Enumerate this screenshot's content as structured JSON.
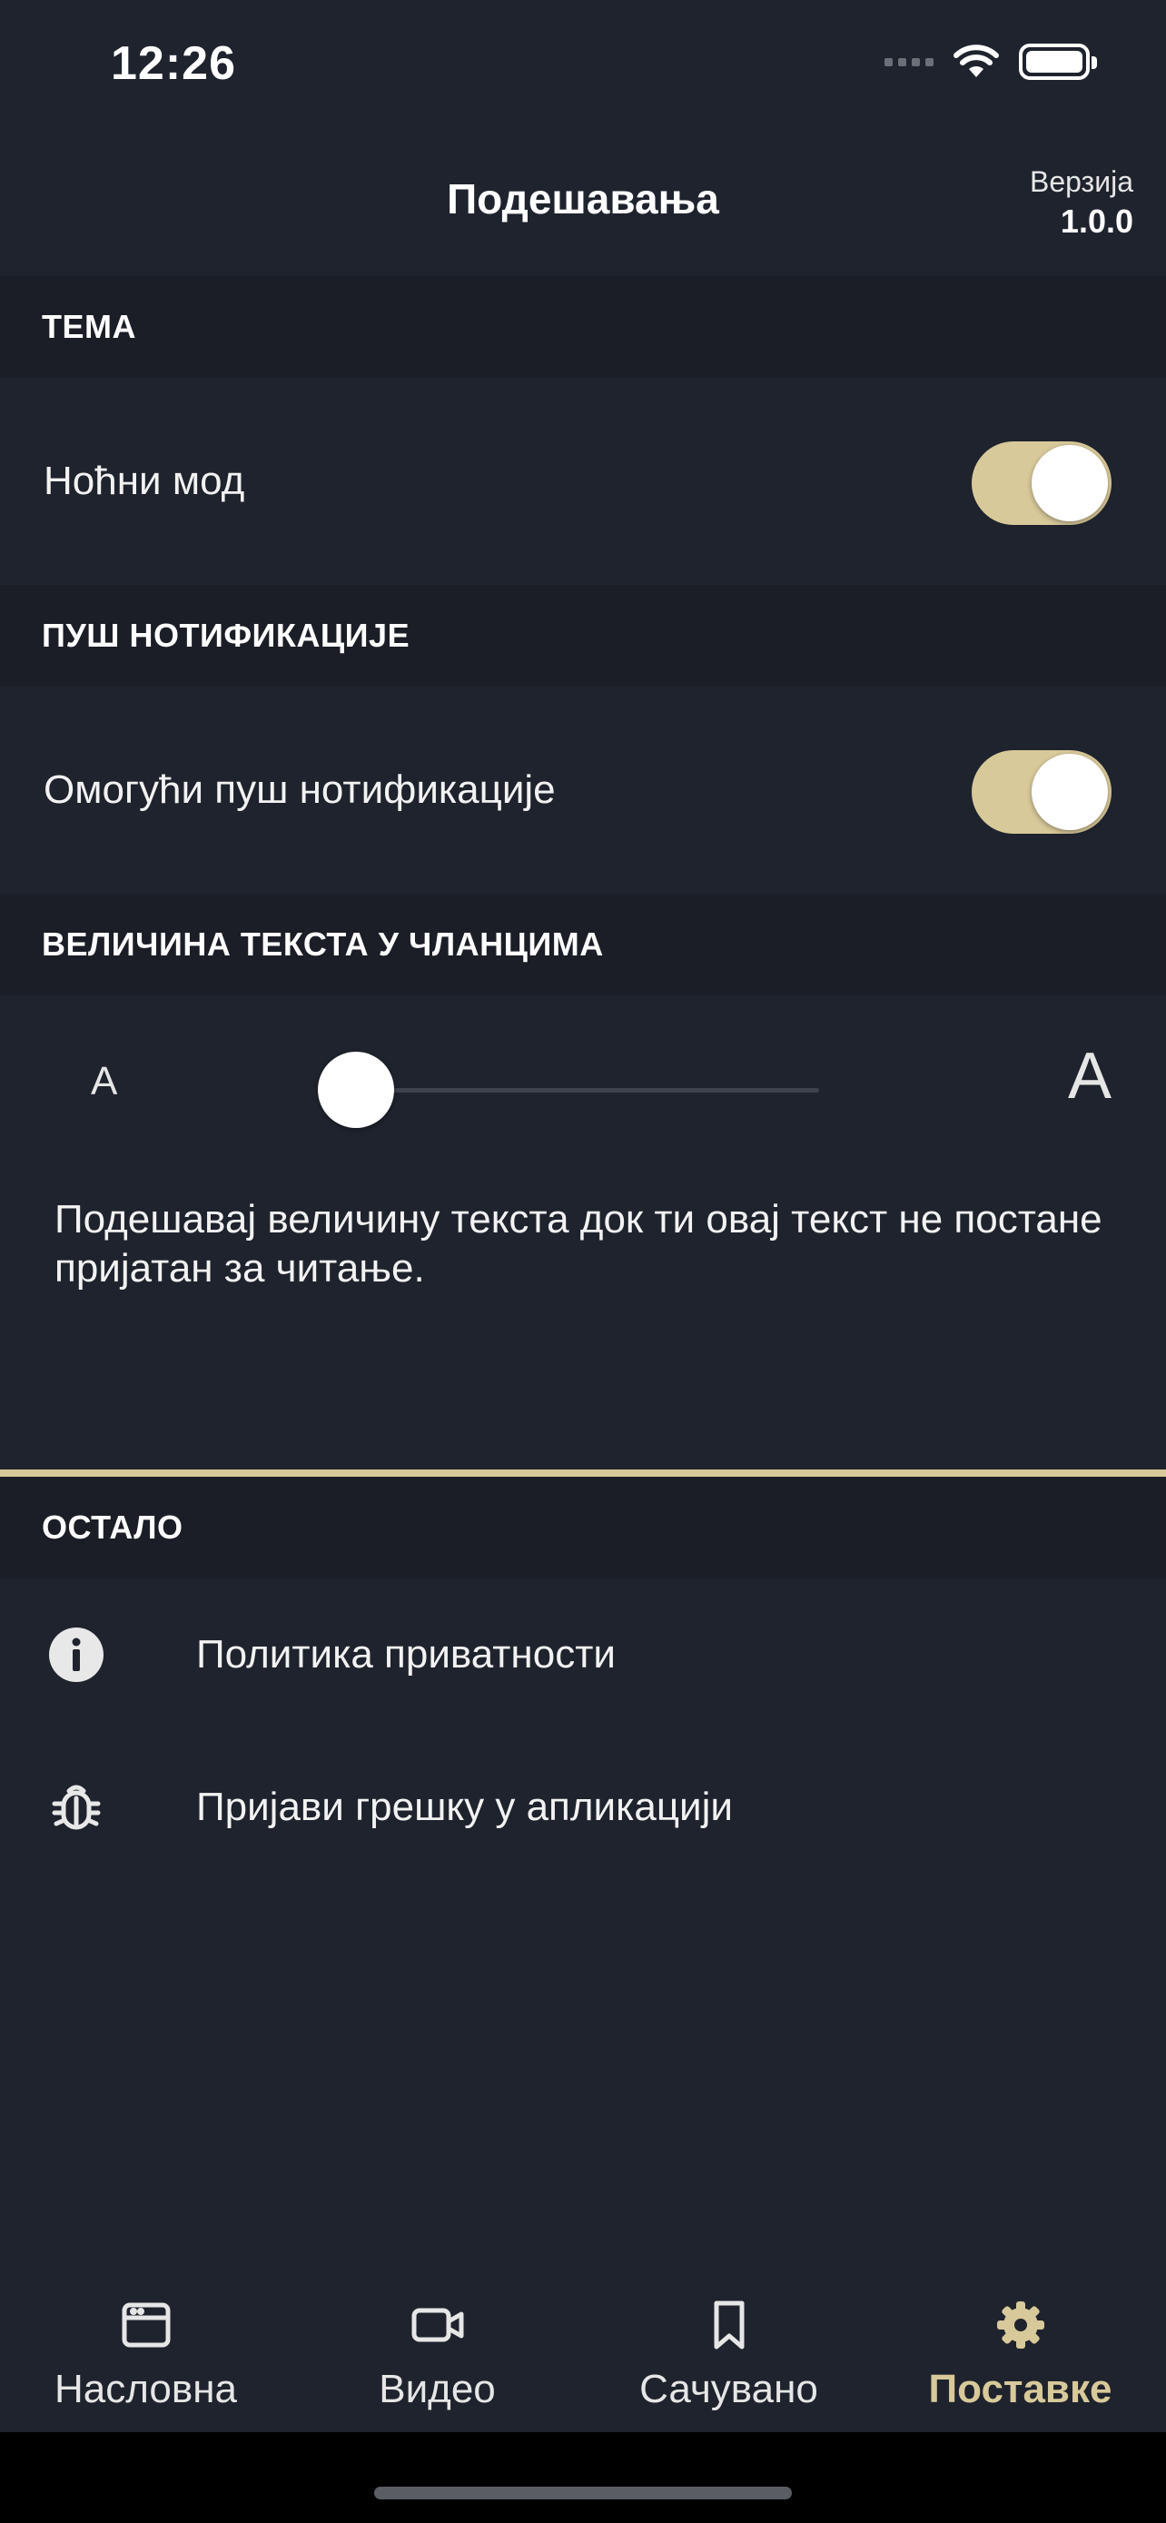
{
  "status_bar": {
    "time": "12:26"
  },
  "header": {
    "title": "Подешавања",
    "version_label": "Верзија",
    "version_value": "1.0.0"
  },
  "sections": {
    "theme": {
      "title": "ТЕМА",
      "night_mode_label": "Ноћни мод",
      "night_mode_on": true
    },
    "push": {
      "title": "ПУШ НОТИФИКАЦИЈЕ",
      "enable_label": "Омогући пуш нотификације",
      "enable_on": true
    },
    "text_size": {
      "title": "ВЕЛИЧИНА ТЕКСТА У ЧЛАНЦИМА",
      "small_label": "A",
      "large_label": "A",
      "slider_value": 0,
      "description": "Подешавај величину текста док ти овај текст не постане пријатан за читање."
    },
    "other": {
      "title": "ОСТАЛО",
      "items": [
        {
          "label": "Политика приватности",
          "icon": "info-icon"
        },
        {
          "label": "Пријави грешку у апликацији",
          "icon": "bug-icon"
        }
      ]
    }
  },
  "tab_bar": {
    "tabs": [
      {
        "label": "Насловна",
        "icon": "browser-window-icon",
        "active": false
      },
      {
        "label": "Видео",
        "icon": "video-camera-icon",
        "active": false
      },
      {
        "label": "Сачувано",
        "icon": "bookmark-icon",
        "active": false
      },
      {
        "label": "Поставке",
        "icon": "gear-icon",
        "active": true
      }
    ]
  },
  "colors": {
    "background": "#1f232d",
    "section_bg": "#1b1e26",
    "accent": "#d8c99a",
    "text": "#ffffff"
  }
}
